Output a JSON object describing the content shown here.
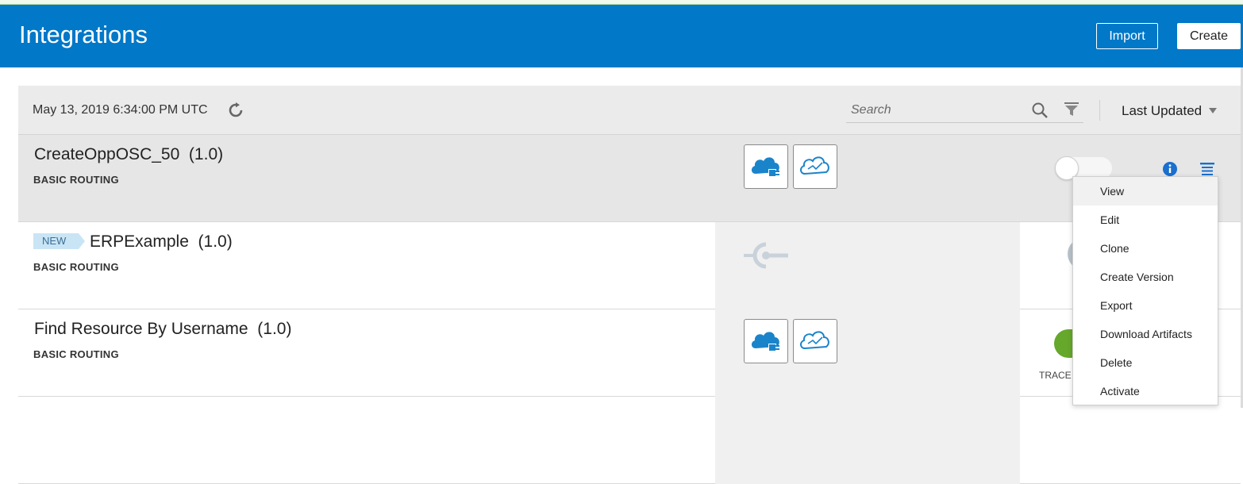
{
  "header": {
    "title": "Integrations",
    "import_label": "Import",
    "create_label": "Create"
  },
  "toolbar": {
    "timestamp": "May 13, 2019 6:34:00 PM UTC",
    "search_placeholder": "Search",
    "sort_label": "Last Updated"
  },
  "rows": [
    {
      "name": "CreateOppOSC_50  (1.0)",
      "pattern": "BASIC ROUTING",
      "status": "inactive"
    },
    {
      "badge": "NEW",
      "name": "ERPExample  (1.0)",
      "pattern": "BASIC ROUTING",
      "status": "unknown"
    },
    {
      "name": "Find Resource By Username  (1.0)",
      "pattern": "BASIC ROUTING",
      "status": "active",
      "trace": "TRACE"
    }
  ],
  "context_menu": {
    "items": [
      "View",
      "Edit",
      "Clone",
      "Create Version",
      "Export",
      "Download Artifacts",
      "Delete",
      "Activate"
    ]
  },
  "colors": {
    "header_bg": "#0178c8",
    "status_green": "#66a82b",
    "icon_blue": "#1a84cb"
  },
  "icons": {
    "refresh": "refresh-icon",
    "search": "search-icon",
    "filter": "filter-icon",
    "caret": "chevron-down-icon",
    "info": "info-icon",
    "menu": "hamburger-menu-icon",
    "adapter_a": "cloud-adapter-icon",
    "adapter_b": "cloud-trigger-icon",
    "plug": "connection-plug-icon"
  }
}
